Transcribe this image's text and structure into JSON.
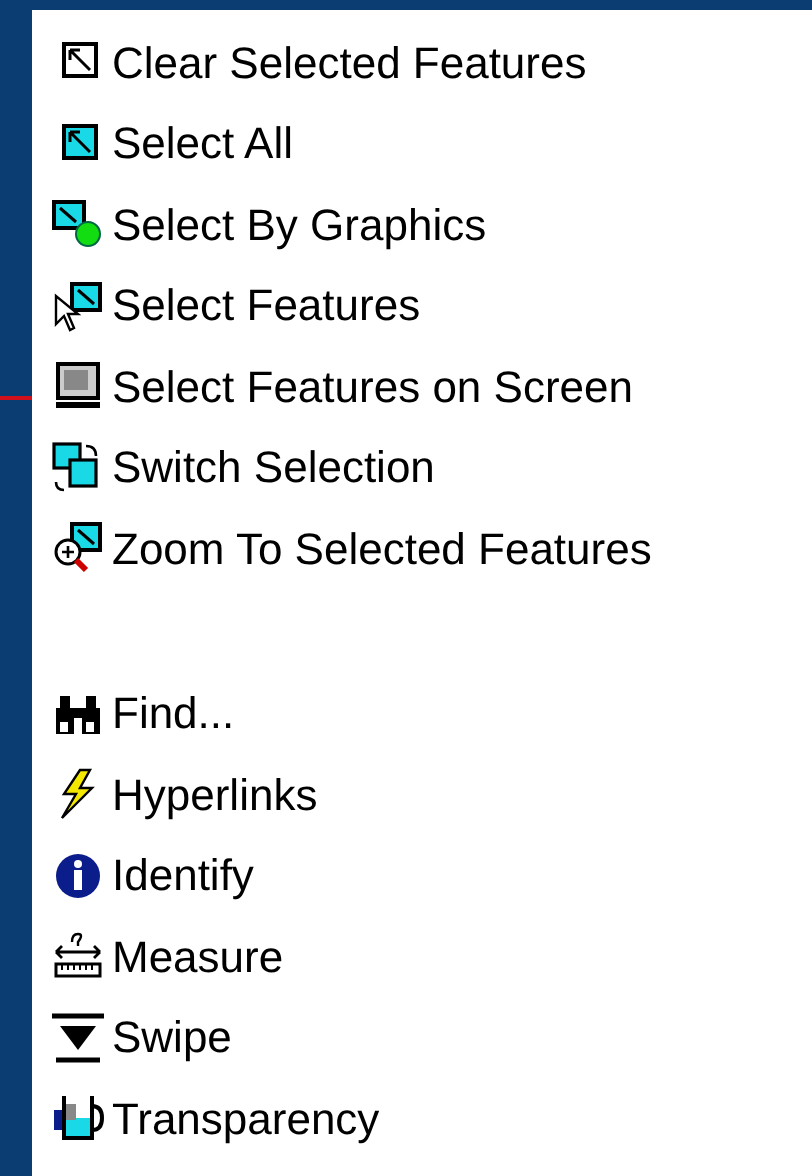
{
  "menu_groups": [
    {
      "items": [
        {
          "kind": "clear",
          "label": "Clear Selected Features"
        },
        {
          "kind": "select-all",
          "label": "Select All"
        },
        {
          "kind": "by-graphics",
          "label": "Select By Graphics"
        },
        {
          "kind": "pointer",
          "label": "Select Features"
        },
        {
          "kind": "screen",
          "label": "Select Features on Screen"
        },
        {
          "kind": "switch",
          "label": "Switch Selection"
        },
        {
          "kind": "zoom",
          "label": "Zoom To Selected Features"
        }
      ]
    },
    {
      "items": [
        {
          "kind": "find",
          "label": "Find..."
        },
        {
          "kind": "hyperlink",
          "label": "Hyperlinks"
        },
        {
          "kind": "identify",
          "label": "Identify"
        },
        {
          "kind": "measure",
          "label": "Measure"
        },
        {
          "kind": "swipe",
          "label": "Swipe"
        },
        {
          "kind": "transparency",
          "label": "Transparency"
        }
      ]
    }
  ]
}
